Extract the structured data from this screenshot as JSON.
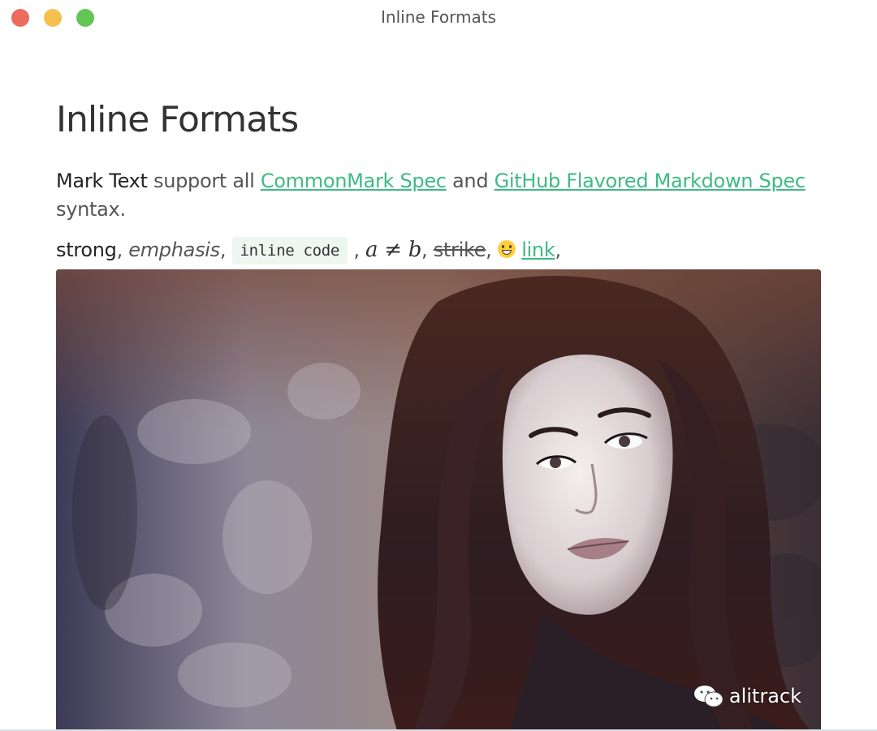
{
  "window": {
    "title": "Inline Formats"
  },
  "document": {
    "heading": "Inline Formats",
    "intro": {
      "brand": "Mark Text",
      "text1": " support all ",
      "link1": "CommonMark Spec",
      "text2": " and ",
      "link2": "GitHub Flavored Markdown Spec",
      "text3": " syntax."
    },
    "inline_examples": {
      "strong": "strong",
      "sep1": ", ",
      "emphasis": "emphasis",
      "sep2": ", ",
      "code": "inline code",
      "sep3": " , ",
      "math_a": "a",
      "math_op": "≠",
      "math_b": "b",
      "sep4": ", ",
      "strike": "strike",
      "sep5": ", ",
      "emoji": "smile-emoji",
      "link": "link",
      "sep6": ","
    },
    "image": {
      "alt": "portrait photo",
      "watermark": "alitrack"
    }
  },
  "colors": {
    "link": "#3fba84",
    "code_bg": "#eef6f1",
    "text": "#555555",
    "heading": "#333333"
  }
}
